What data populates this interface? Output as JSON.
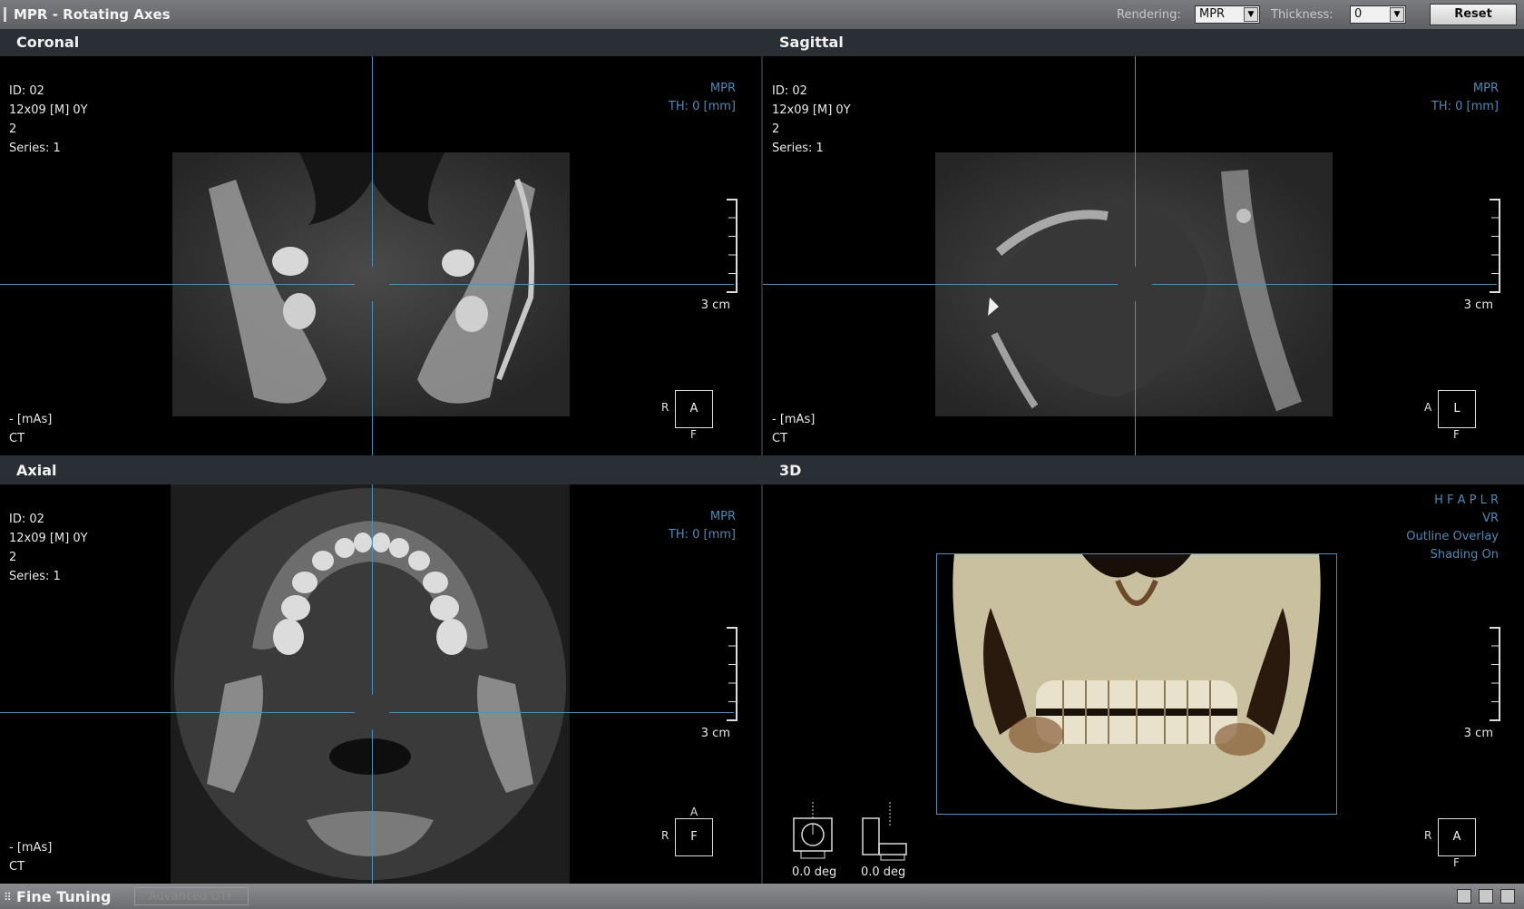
{
  "window": {
    "title": "MPR - Rotating Axes"
  },
  "toolbar": {
    "rendering_label": "Rendering:",
    "rendering_value": "MPR",
    "thickness_label": "Thickness:",
    "thickness_value": "0",
    "reset_label": "Reset"
  },
  "panels": {
    "coronal": {
      "title": "Coronal",
      "info": [
        "ID: 02",
        "12x09 [M] 0Y",
        "2",
        "Series: 1"
      ],
      "mode": "MPR",
      "thickness": "TH: 0 [mm]",
      "footer": [
        "- [mAs]",
        "CT"
      ],
      "scale": "3 cm",
      "orient": {
        "box": "A",
        "left": "R",
        "bottom": "F"
      }
    },
    "sagittal": {
      "title": "Sagittal",
      "info": [
        "ID: 02",
        "12x09 [M] 0Y",
        "2",
        "Series: 1"
      ],
      "mode": "MPR",
      "thickness": "TH: 0 [mm]",
      "footer": [
        "- [mAs]",
        "CT"
      ],
      "scale": "3 cm",
      "orient": {
        "box": "L",
        "left": "A",
        "bottom": "F"
      }
    },
    "axial": {
      "title": "Axial",
      "info": [
        "ID: 02",
        "12x09 [M] 0Y",
        "2",
        "Series: 1"
      ],
      "mode": "MPR",
      "thickness": "TH: 0 [mm]",
      "footer": [
        "- [mAs]",
        "CT"
      ],
      "scale": "3 cm",
      "orient": {
        "box": "F",
        "left": "R",
        "top": "A"
      }
    },
    "three_d": {
      "title": "3D",
      "labels": [
        "H F A P L R",
        "VR",
        "Outline Overlay",
        "Shading On"
      ],
      "scale": "3 cm",
      "orient": {
        "box": "A",
        "left": "R",
        "bottom": "F"
      },
      "rotation_1": "0.0 deg",
      "rotation_2": "0.0 deg"
    }
  },
  "statusbar": {
    "fine_tuning": "Fine Tuning",
    "advanced": "Advanced OTF"
  }
}
